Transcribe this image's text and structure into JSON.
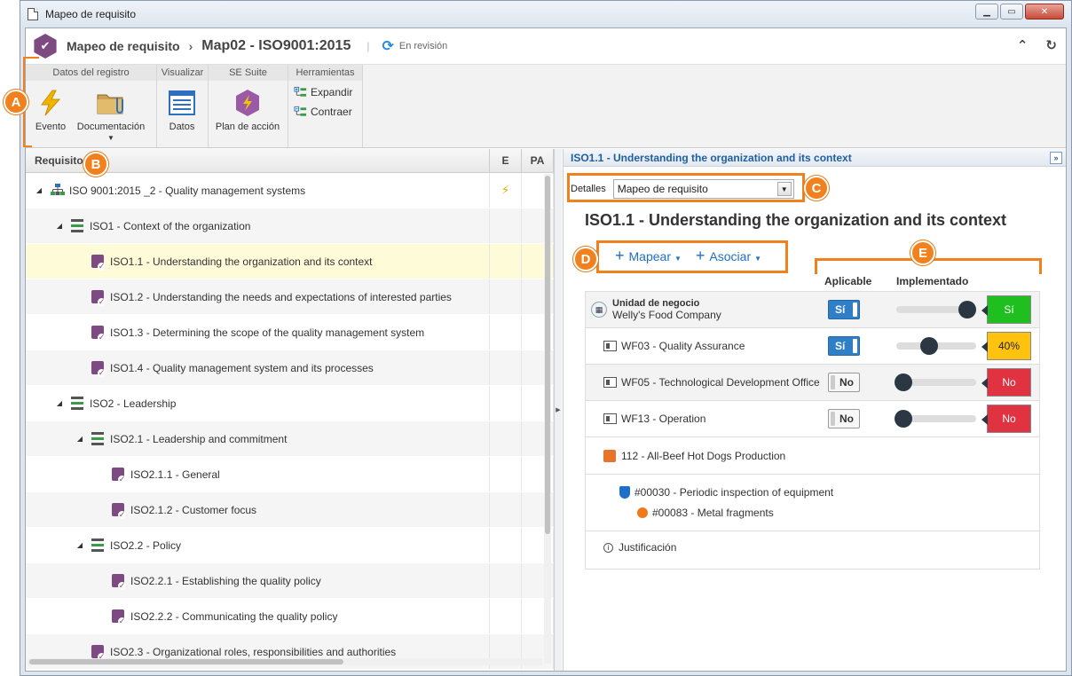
{
  "window": {
    "title": "Mapeo de requisito"
  },
  "header": {
    "app_name": "Mapeo de requisito",
    "separator": "›",
    "record": "Map02 - ISO9001:2015",
    "pipe": "|",
    "status": "En revisión",
    "status_icon": "sync-icon"
  },
  "ribbon": {
    "groups": [
      {
        "title": "Datos del registro",
        "buttons": [
          "Evento",
          "Documentación"
        ]
      },
      {
        "title": "Visualizar",
        "buttons": [
          "Datos"
        ]
      },
      {
        "title": "SE Suite",
        "buttons": [
          "Plan de acción"
        ]
      },
      {
        "title": "Herramientas",
        "buttons": [
          "Expandir",
          "Contraer"
        ]
      }
    ]
  },
  "left": {
    "columns": {
      "req": "Requisito",
      "e": "E",
      "pa": "PA"
    },
    "rows": [
      {
        "level": 0,
        "label": "ISO 9001:2015 _2 - Quality management systems",
        "type": "tree",
        "expanded": true,
        "event": "⚡"
      },
      {
        "level": 1,
        "label": "ISO1 - Context of the organization",
        "type": "group",
        "expanded": true
      },
      {
        "level": 2,
        "label": "ISO1.1 - Understanding the organization and its context",
        "type": "req",
        "selected": true
      },
      {
        "level": 2,
        "label": "ISO1.2 - Understanding the needs and expectations of interested parties",
        "type": "req"
      },
      {
        "level": 2,
        "label": "ISO1.3 - Determining the scope of the quality management system",
        "type": "req"
      },
      {
        "level": 2,
        "label": "ISO1.4 - Quality management system and its processes",
        "type": "req"
      },
      {
        "level": 1,
        "label": "ISO2 - Leadership",
        "type": "group",
        "expanded": true
      },
      {
        "level": 2,
        "label": "ISO2.1 - Leadership and commitment",
        "type": "group",
        "expanded": true
      },
      {
        "level": 3,
        "label": "ISO2.1.1 - General",
        "type": "req"
      },
      {
        "level": 3,
        "label": "ISO2.1.2 - Customer focus",
        "type": "req"
      },
      {
        "level": 2,
        "label": "ISO2.2 - Policy",
        "type": "group",
        "expanded": true
      },
      {
        "level": 3,
        "label": "ISO2.2.1 - Establishing the quality policy",
        "type": "req"
      },
      {
        "level": 3,
        "label": "ISO2.2.2 - Communicating the quality policy",
        "type": "req"
      },
      {
        "level": 2,
        "label": "ISO2.3 - Organizational roles, responsibilities and authorities",
        "type": "req"
      }
    ]
  },
  "right": {
    "panel_title": "ISO1.1 - Understanding the organization and its context",
    "details_label": "Detalles",
    "details_value": "Mapeo de requisito",
    "title": "ISO1.1 - Understanding the organization and its context",
    "actions": {
      "map": "Mapear",
      "associate": "Asociar"
    },
    "col_applicable": "Aplicable",
    "col_implemented": "Implementado",
    "unit_label": "Unidad de negocio",
    "unit_name": "Welly's Food Company",
    "unit_toggle": "Sí",
    "unit_level": 1.0,
    "unit_badge": "Sí",
    "depts": [
      {
        "name": "WF03 - Quality Assurance",
        "toggle": "Sí",
        "level": 0.4,
        "badge": "40%",
        "color": "#ffc20e"
      },
      {
        "name": "WF05 - Technological Development Office",
        "toggle": "No",
        "level": 0.0,
        "badge": "No",
        "color": "#e03241"
      },
      {
        "name": "WF13 - Operation",
        "toggle": "No",
        "level": 0.0,
        "badge": "No",
        "color": "#e03241"
      }
    ],
    "process": "112 - All-Beef Hot Dogs Production",
    "risk": "#00030 - Periodic inspection of equipment",
    "hazard": "#00083 - Metal fragments",
    "justification": "Justificación"
  },
  "callouts": {
    "a": "A",
    "b": "B",
    "c": "C",
    "d": "D",
    "e": "E"
  },
  "colors": {
    "accent": "#f0811e",
    "brand": "#7d4a82",
    "link": "#1e6fc8"
  }
}
